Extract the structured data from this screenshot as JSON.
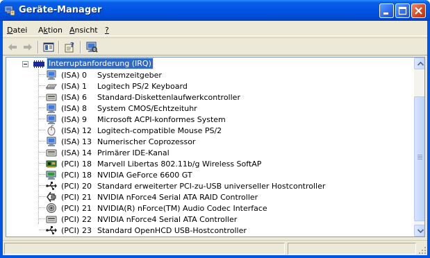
{
  "window": {
    "title": "Geräte-Manager"
  },
  "menu": [
    {
      "label": "Datei",
      "mnemonic": "D"
    },
    {
      "label": "Aktion",
      "mnemonic": "k"
    },
    {
      "label": "Ansicht",
      "mnemonic": "A"
    },
    {
      "label": "?",
      "mnemonic": "?"
    }
  ],
  "tree": {
    "root_label": "Interruptanforderung (IRQ)",
    "items": [
      {
        "bus": "(ISA)",
        "irq": "0",
        "name": "Systemzeitgeber",
        "icon": "monitor-icon"
      },
      {
        "bus": "(ISA)",
        "irq": "1",
        "name": "Logitech PS/2 Keyboard",
        "icon": "keyboard-icon"
      },
      {
        "bus": "(ISA)",
        "irq": "6",
        "name": "Standard-Diskettenlaufwerkcontroller",
        "icon": "drive-controller-icon"
      },
      {
        "bus": "(ISA)",
        "irq": "8",
        "name": "System CMOS/Echtzeituhr",
        "icon": "monitor-icon"
      },
      {
        "bus": "(ISA)",
        "irq": "9",
        "name": "Microsoft ACPI-konformes System",
        "icon": "monitor-icon"
      },
      {
        "bus": "(ISA)",
        "irq": "12",
        "name": "Logitech-compatible Mouse PS/2",
        "icon": "mouse-icon"
      },
      {
        "bus": "(ISA)",
        "irq": "13",
        "name": "Numerischer Coprozessor",
        "icon": "monitor-icon"
      },
      {
        "bus": "(ISA)",
        "irq": "14",
        "name": "Primärer IDE-Kanal",
        "icon": "drive-controller-icon"
      },
      {
        "bus": "(PCI)",
        "irq": "18",
        "name": "Marvell Libertas 802.11b/g Wireless SoftAP",
        "icon": "network-card-icon"
      },
      {
        "bus": "(PCI)",
        "irq": "18",
        "name": "NVIDIA GeForce 6600 GT",
        "icon": "display-adapter-icon"
      },
      {
        "bus": "(PCI)",
        "irq": "20",
        "name": "Standard erweiterter PCI-zu-USB universeller Hostcontroller",
        "icon": "usb-icon"
      },
      {
        "bus": "(PCI)",
        "irq": "21",
        "name": "NVIDIA nForce4 Serial ATA RAID Controller",
        "icon": "raid-controller-icon"
      },
      {
        "bus": "(PCI)",
        "irq": "21",
        "name": "NVIDIA(R) nForce(TM) Audio Codec Interface",
        "icon": "audio-icon"
      },
      {
        "bus": "(PCI)",
        "irq": "22",
        "name": "NVIDIA nForce4 Serial ATA Controller",
        "icon": "drive-controller-icon"
      },
      {
        "bus": "(PCI)",
        "irq": "23",
        "name": "Standard OpenHCD USB-Hostcontroller",
        "icon": "usb-icon"
      }
    ]
  },
  "toolbar": {
    "buttons": [
      "back-arrow-icon",
      "forward-arrow-icon",
      "show-hide-tree-icon",
      "properties-help-icon",
      "scan-hardware-icon"
    ]
  },
  "colors": {
    "selection": "#316ac5",
    "titlebar": "#0054e3",
    "face": "#ece9d8"
  }
}
